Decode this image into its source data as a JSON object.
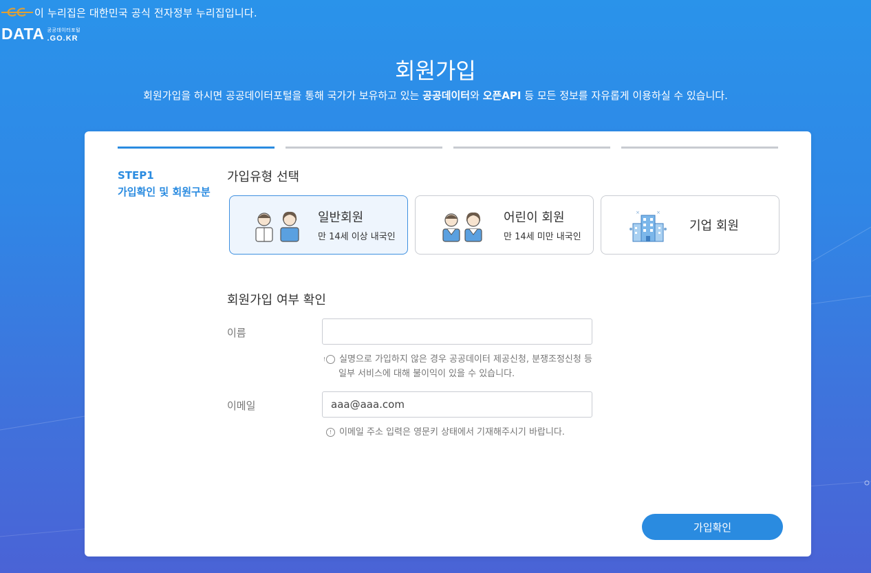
{
  "gov_banner": {
    "text": "이 누리집은 대한민국 공식 전자정부 누리집입니다."
  },
  "logo": {
    "main": "DATA",
    "sub": "공공데이터포털",
    "domain": ".GO.KR"
  },
  "header": {
    "title": "회원가입",
    "description_parts": [
      "회원가입을 하시면 공공데이터포털을 통해 국가가 보유하고 있는 ",
      "공공데이터",
      "와 ",
      "오픈API",
      " 등 모든 정보를 자유롭게 이용하실 수 있습니다."
    ]
  },
  "steps": {
    "active_index": 0,
    "count": 4,
    "current_label": "STEP1",
    "current_desc": "가입확인 및 회원구분"
  },
  "join_type": {
    "title": "가입유형 선택",
    "options": [
      {
        "name": "일반회원",
        "desc": "만 14세 이상 내국인",
        "selected": true,
        "icon": "adults-icon"
      },
      {
        "name": "어린이 회원",
        "desc": "만 14세 미만 내국인",
        "selected": false,
        "icon": "children-icon"
      },
      {
        "name": "기업 회원",
        "desc": "",
        "selected": false,
        "icon": "building-icon"
      }
    ]
  },
  "verify": {
    "title": "회원가입 여부 확인",
    "name_label": "이름",
    "name_value": "",
    "name_hint": "실명으로 가입하지 않은 경우 공공데이터 제공신청, 분쟁조정신청 등 일부 서비스에 대해 불이익이 있을 수 있습니다.",
    "email_label": "이메일",
    "email_value": "aaa@aaa.com",
    "email_hint": "이메일 주소 입력은 영문키 상태에서 기재해주시기 바랍니다.",
    "hint_icon": "!"
  },
  "actions": {
    "confirm_label": "가입확인"
  },
  "colors": {
    "primary": "#2a8be0",
    "bg_top": "#2a93ea",
    "bg_bottom": "#4a63d6"
  }
}
